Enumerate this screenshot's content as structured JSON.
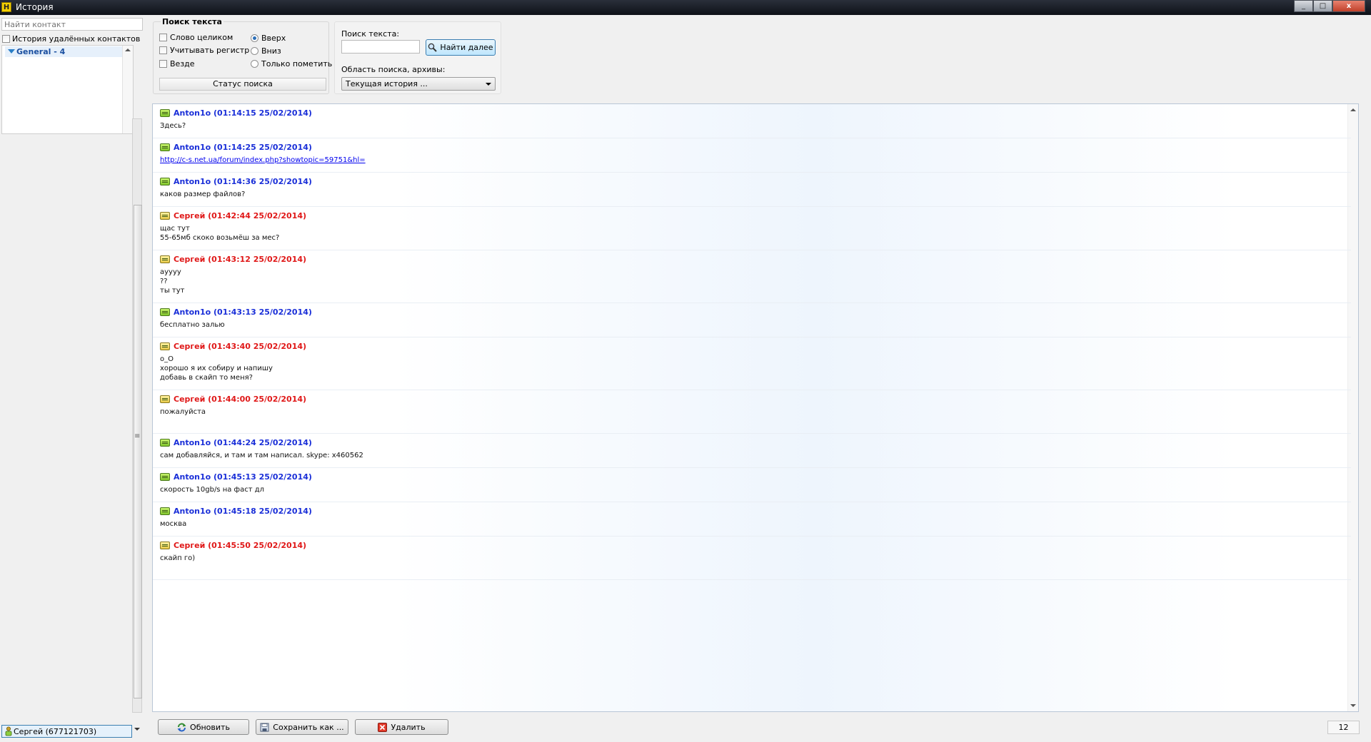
{
  "window": {
    "title": "История",
    "app_icon": "H"
  },
  "sidebar": {
    "find_contact_placeholder": "Найти контакт",
    "deleted_contacts_label": "История удалённых контактов",
    "group_label": "General - 4",
    "account_label": "Сергей (677121703)"
  },
  "search": {
    "legend": "Поиск текста",
    "whole_word": "Слово целиком",
    "match_case": "Учитывать регистр",
    "everywhere": "Везде",
    "dir_up": "Вверх",
    "dir_down": "Вниз",
    "only_mark": "Только пометить",
    "status_label": "Статус поиска",
    "search_text_label": "Поиск текста:",
    "find_next_label": "Найти далее",
    "area_label": "Область поиска, архивы:",
    "area_value": "Текущая история ..."
  },
  "messages": [
    {
      "sender": "Anton1o (01:14:15 25/02/2014)",
      "dir": "in",
      "lines": [
        "Здесь?"
      ]
    },
    {
      "sender": "Anton1o (01:14:25 25/02/2014)",
      "dir": "in",
      "lines": [],
      "link": "http://c-s.net.ua/forum/index.php?showtopic=59751&hl="
    },
    {
      "sender": "Anton1o (01:14:36 25/02/2014)",
      "dir": "in",
      "lines": [
        "каков размер файлов?"
      ]
    },
    {
      "sender": "Сергей (01:42:44 25/02/2014)",
      "dir": "out",
      "lines": [
        "щас тут",
        "55-65мб скоко возьмёш за мес?"
      ]
    },
    {
      "sender": "Сергей (01:43:12 25/02/2014)",
      "dir": "out",
      "lines": [
        "ayyyy",
        "??",
        "ты тут"
      ]
    },
    {
      "sender": "Anton1o (01:43:13 25/02/2014)",
      "dir": "in",
      "lines": [
        "бесплатно залью"
      ]
    },
    {
      "sender": "Сергей (01:43:40 25/02/2014)",
      "dir": "out",
      "lines": [
        "o_O",
        "хорошо я их собиру и напишу",
        "добавь в скайп то меня?"
      ]
    },
    {
      "sender": "Сергей (01:44:00 25/02/2014)",
      "dir": "out",
      "lines": [
        "пожалуйста"
      ]
    },
    {
      "sender": "Anton1o (01:44:24 25/02/2014)",
      "dir": "in",
      "lines": [
        "сам добавляйся, и там и там написал. skype: x460562"
      ]
    },
    {
      "sender": "Anton1o (01:45:13 25/02/2014)",
      "dir": "in",
      "lines": [
        "скорость 10gb/s на фаст дл"
      ]
    },
    {
      "sender": "Anton1o (01:45:18 25/02/2014)",
      "dir": "in",
      "lines": [
        "москва"
      ]
    },
    {
      "sender": "Сергей (01:45:50 25/02/2014)",
      "dir": "out",
      "lines": [
        "скайп го)"
      ]
    }
  ],
  "toolbar": {
    "refresh": "Обновить",
    "save_as": "Сохранить как ...",
    "delete": "Удалить"
  },
  "message_count": "12",
  "colors": {
    "incoming": "#1a2fd8",
    "outgoing": "#e01818"
  }
}
